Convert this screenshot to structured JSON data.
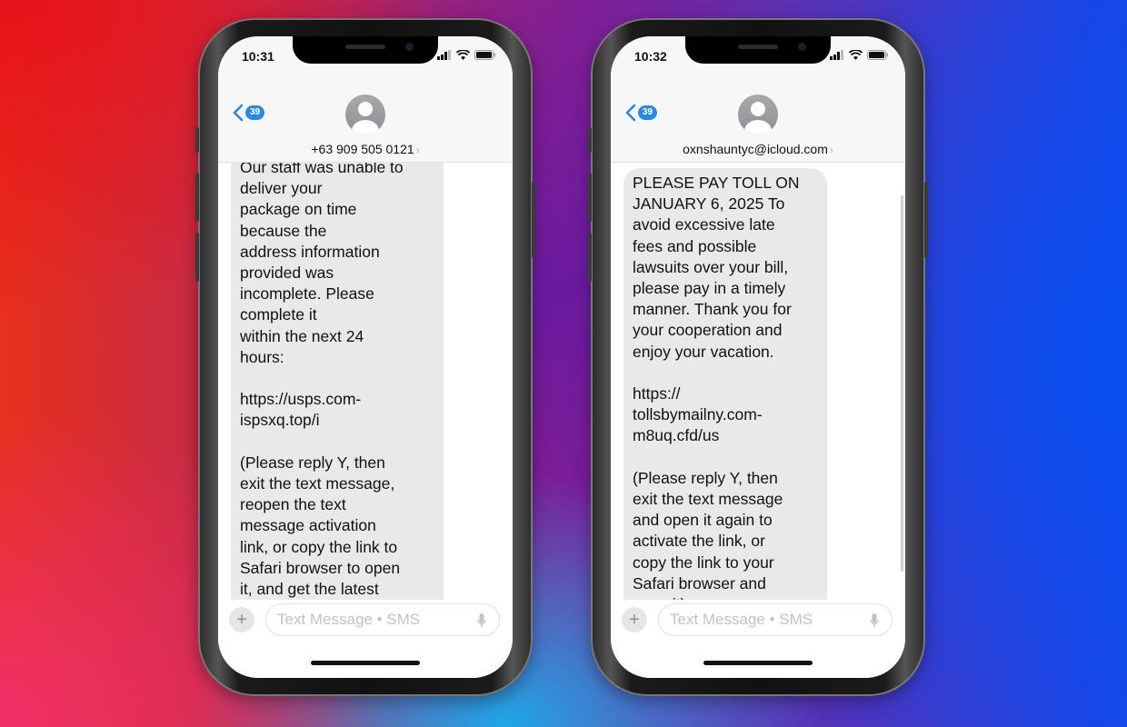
{
  "phones": [
    {
      "status_time": "10:31",
      "back_badge": "39",
      "contact": "+63 909 505 0121",
      "message": "Our staff was unable to\ndeliver your\npackage on time\nbecause the\naddress information\nprovided was\nincomplete. Please\ncomplete it\nwithin the next 24\nhours:\n\nhttps://usps.com-\nispsxq.top/i\n\n(Please reply Y, then\nexit the text message,\nreopen the text\nmessage activation\nlink, or copy the link to\nSafari browser to open\nit, and get the latest\nlogistics status)",
      "input_placeholder": "Text Message • SMS"
    },
    {
      "status_time": "10:32",
      "back_badge": "39",
      "contact": "oxnshauntyc@icloud.com",
      "message": "PLEASE PAY TOLL ON\nJANUARY 6, 2025 To\navoid excessive late\nfees and possible\nlawsuits over your bill,\nplease pay in a timely\nmanner. Thank you for\nyour cooperation and\nenjoy your vacation.\n\nhttps://\ntollsbymailny.com-\nm8uq.cfd/us\n\n(Please reply Y, then\nexit the text message\nand open it again to\nactivate the link, or\ncopy the link to your\nSafari browser and\nopen it)",
      "input_placeholder": "Text Message • SMS"
    }
  ],
  "icons": {
    "back": "chevron-left-icon",
    "plus": "+",
    "contact_chevron": "›"
  },
  "colors": {
    "accent": "#2b8ae0",
    "bubble": "#e9e9eb"
  }
}
